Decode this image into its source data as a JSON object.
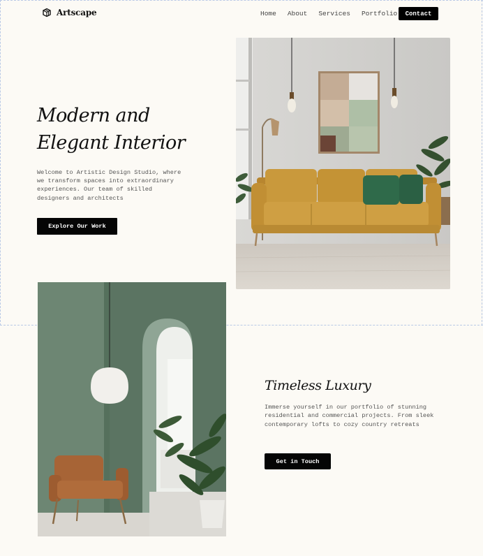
{
  "nav": {
    "brand": "Artscape",
    "links": [
      "Home",
      "About",
      "Services",
      "Portfolio"
    ],
    "contact_label": "Contact"
  },
  "hero": {
    "title_line1": "Modern and",
    "title_line2": "Elegant Interior",
    "description": "Welcome to Artistic Design Studio, where we transform spaces into extraordinary experiences. Our team of skilled designers and architects",
    "cta_label": "Explore Our Work"
  },
  "section2": {
    "title": "Timeless Luxury",
    "description": "Immerse yourself in our portfolio of stunning residential and commercial projects. From sleek contemporary lofts to cozy country retreats",
    "cta_label": "Get in Touch"
  },
  "colors": {
    "background": "#fcfaf5",
    "button": "#050505",
    "sofa": "#c9993c",
    "wall_green": "#67806d"
  }
}
